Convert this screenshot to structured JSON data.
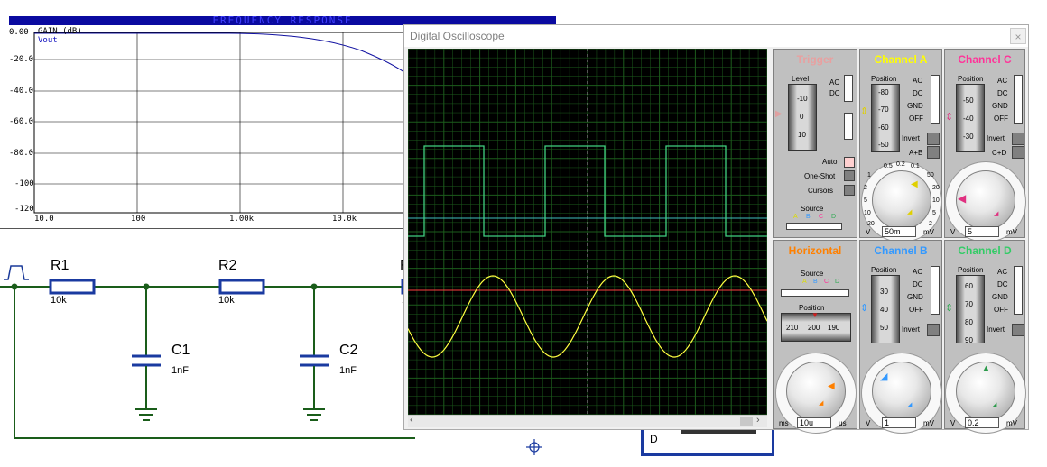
{
  "graph": {
    "title": "FREQUENCY RESPONSE",
    "legend_gain": "GAIN (dB)",
    "legend_vout": "Vout",
    "y_ticks": [
      "0.00",
      "-20.0",
      "-40.0",
      "-60.0",
      "-80.0",
      "-100",
      "-120"
    ],
    "x_ticks": [
      "10.0",
      "100",
      "1.00k",
      "10.0k"
    ]
  },
  "schematic": {
    "r1_name": "R1",
    "r1_value": "10k",
    "r2_name": "R2",
    "r2_value": "10k",
    "r3_name_partial": "R",
    "r3_value_partial": "1",
    "c1_name": "C1",
    "c1_value": "1nF",
    "c2_name": "C2",
    "c2_value": "1nF",
    "d_label": "D"
  },
  "oscilloscope": {
    "window_title": "Digital Oscilloscope",
    "close_glyph": "×",
    "trigger": {
      "title": "Trigger",
      "title_color": "#e8a0a0",
      "level_label": "Level",
      "level_scale": [
        "-10",
        "0",
        "10"
      ],
      "ac": "AC",
      "dc": "DC",
      "auto": "Auto",
      "one_shot": "One-Shot",
      "cursors": "Cursors",
      "source_label": "Source",
      "source_letters": [
        "A",
        "B",
        "C",
        "D"
      ]
    },
    "channel_a": {
      "title": "Channel A",
      "title_color": "#ffff00",
      "position_label": "Position",
      "position_scale": [
        "-80",
        "-70",
        "-60",
        "-50"
      ],
      "ac": "AC",
      "dc": "DC",
      "gnd": "GND",
      "off": "OFF",
      "invert": "Invert",
      "extra": "A+B",
      "knob_labels": [
        "0.5",
        "0.2",
        "0.1",
        "1",
        "50",
        "2",
        "20",
        "5",
        "10",
        "10",
        "5",
        "20",
        "2"
      ],
      "unit_left": "V",
      "value": "50m",
      "unit_right": "mV"
    },
    "channel_c": {
      "title": "Channel C",
      "title_color": "#ff3399",
      "position_label": "Position",
      "position_scale": [
        "-50",
        "-40",
        "-30"
      ],
      "ac": "AC",
      "dc": "DC",
      "gnd": "GND",
      "off": "OFF",
      "invert": "Invert",
      "extra": "C+D",
      "unit_left": "V",
      "value": "5",
      "unit_right": "mV"
    },
    "horizontal": {
      "title": "Horizontal",
      "title_color": "#ff8000",
      "source_label": "Source",
      "source_letters": [
        "A",
        "B",
        "C",
        "D"
      ],
      "position_label": "Position",
      "position_scale": [
        "210",
        "200",
        "190"
      ],
      "unit_left": "ms",
      "value": "10u",
      "unit_right": "μs"
    },
    "channel_b": {
      "title": "Channel B",
      "title_color": "#3399ff",
      "position_label": "Position",
      "position_scale": [
        "30",
        "40",
        "50"
      ],
      "ac": "AC",
      "dc": "DC",
      "gnd": "GND",
      "off": "OFF",
      "invert": "Invert",
      "unit_left": "V",
      "value": "1",
      "unit_right": "mV"
    },
    "channel_d": {
      "title": "Channel D",
      "title_color": "#33cc66",
      "position_label": "Position",
      "position_scale": [
        "60",
        "70",
        "80",
        "90"
      ],
      "ac": "AC",
      "dc": "DC",
      "gnd": "GND",
      "off": "OFF",
      "invert": "Invert",
      "unit_left": "V",
      "value": "0.2",
      "unit_right": "mV"
    },
    "trace_colors": {
      "channel_a": "#ffff40",
      "channel_d": "#40d080",
      "trigger_line": "#ff4040",
      "cyan_line": "#40c0c0",
      "grid": "#1c5c1c"
    }
  }
}
